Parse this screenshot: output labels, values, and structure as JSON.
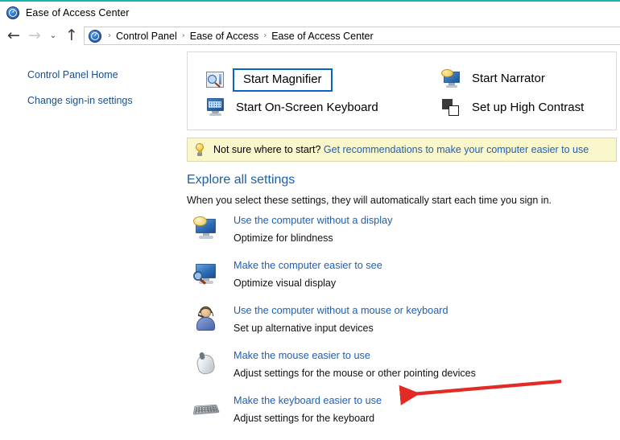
{
  "window": {
    "title": "Ease of Access Center",
    "title_icon": "ease-of-access-icon",
    "accent_color": "#12b5b0"
  },
  "navigation": {
    "back_label": "←",
    "forward_label": "→",
    "recent_label": "⌄",
    "up_label": "↑",
    "breadcrumb_icon": "ease-of-access-icon",
    "breadcrumb": [
      {
        "label": "Control Panel"
      },
      {
        "label": "Ease of Access"
      },
      {
        "label": "Ease of Access Center"
      }
    ],
    "separator": "›"
  },
  "sidebar": {
    "items": [
      {
        "label": "Control Panel Home",
        "icon": "none"
      },
      {
        "label": "Change sign-in settings",
        "icon": "shield-icon"
      }
    ]
  },
  "quick_access": {
    "items": [
      {
        "label": "Start Magnifier",
        "icon": "magnifier-icon",
        "focused": true
      },
      {
        "label": "Start Narrator",
        "icon": "narrator-icon",
        "focused": false
      },
      {
        "label": "Start On-Screen Keyboard",
        "icon": "on-screen-keyboard-icon",
        "focused": false
      },
      {
        "label": "Set up High Contrast",
        "icon": "high-contrast-icon",
        "focused": false
      }
    ],
    "focus_color": "#0a64c8"
  },
  "info_bar": {
    "icon": "lightbulb-icon",
    "prompt": "Not sure where to start?",
    "link": "Get recommendations to make your computer easier to use",
    "background": "#fbf7cd",
    "border": "#ded9a4"
  },
  "explore": {
    "heading": "Explore all settings",
    "subheading": "When you select these settings, they will automatically start each time you sign in.",
    "heading_color": "#1a5fa8",
    "link_color": "#1a60b8",
    "settings": [
      {
        "link": "Use the computer without a display",
        "description": "Optimize for blindness",
        "icon": "monitor-speech-icon"
      },
      {
        "link": "Make the computer easier to see",
        "description": "Optimize visual display",
        "icon": "monitor-magnifier-icon"
      },
      {
        "link": "Use the computer without a mouse or keyboard",
        "description": "Set up alternative input devices",
        "icon": "person-headset-icon"
      },
      {
        "link": "Make the mouse easier to use",
        "description": "Adjust settings for the mouse or other pointing devices",
        "icon": "mouse-icon"
      },
      {
        "link": "Make the keyboard easier to use",
        "description": "Adjust settings for the keyboard",
        "icon": "keyboard-icon"
      }
    ]
  },
  "annotation": {
    "type": "red-arrow",
    "color": "#e32b26",
    "points_to": "Make the keyboard easier to use"
  }
}
